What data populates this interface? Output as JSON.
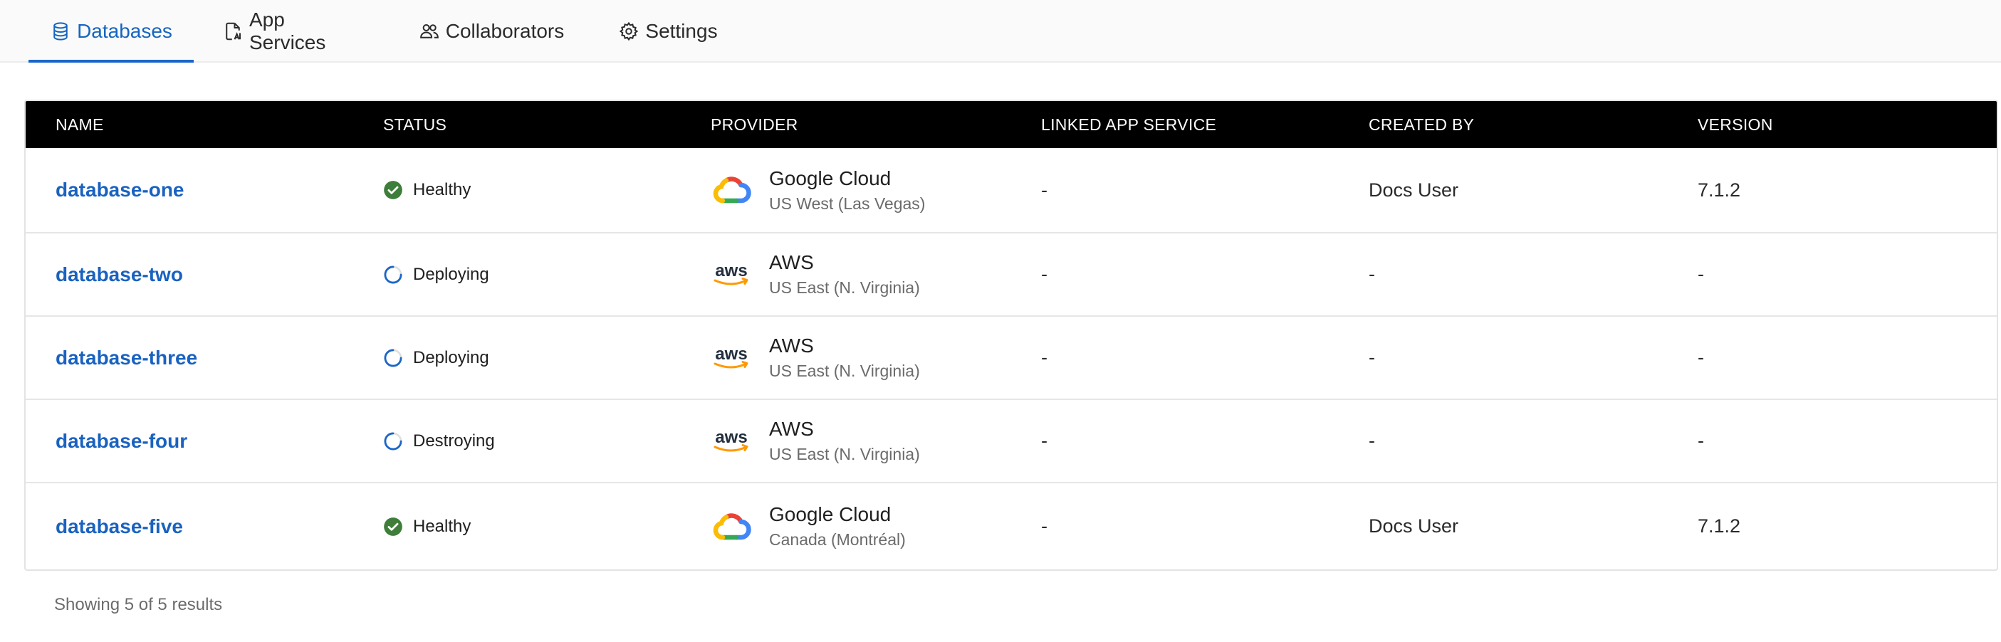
{
  "tabs": [
    {
      "label": "Databases",
      "icon": "database-icon",
      "active": true
    },
    {
      "label": "App Services",
      "icon": "app-services-icon",
      "active": false
    },
    {
      "label": "Collaborators",
      "icon": "people-icon",
      "active": false
    },
    {
      "label": "Settings",
      "icon": "gear-icon",
      "active": false
    }
  ],
  "table": {
    "headers": [
      "NAME",
      "STATUS",
      "PROVIDER",
      "LINKED APP SERVICE",
      "CREATED BY",
      "VERSION"
    ],
    "rows": [
      {
        "name": "database-one",
        "status": "Healthy",
        "status_icon": "check-circle-icon",
        "provider": "Google Cloud",
        "provider_icon": "google-cloud-logo",
        "region": "US West (Las Vegas)",
        "linked": "-",
        "created_by": "Docs User",
        "version": "7.1.2"
      },
      {
        "name": "database-two",
        "status": "Deploying",
        "status_icon": "spinner-icon",
        "provider": "AWS",
        "provider_icon": "aws-logo",
        "region": "US East (N. Virginia)",
        "linked": "-",
        "created_by": "-",
        "version": "-"
      },
      {
        "name": "database-three",
        "status": "Deploying",
        "status_icon": "spinner-icon",
        "provider": "AWS",
        "provider_icon": "aws-logo",
        "region": "US East (N. Virginia)",
        "linked": "-",
        "created_by": "-",
        "version": "-"
      },
      {
        "name": "database-four",
        "status": "Destroying",
        "status_icon": "spinner-icon",
        "provider": "AWS",
        "provider_icon": "aws-logo",
        "region": "US East (N. Virginia)",
        "linked": "-",
        "created_by": "-",
        "version": "-"
      },
      {
        "name": "database-five",
        "status": "Healthy",
        "status_icon": "check-circle-icon",
        "provider": "Google Cloud",
        "provider_icon": "google-cloud-logo",
        "region": "Canada (Montréal)",
        "linked": "-",
        "created_by": "Docs User",
        "version": "7.1.2"
      }
    ]
  },
  "footer": {
    "results_text": "Showing 5 of 5 results"
  },
  "colors": {
    "accent": "#1a62c0",
    "header_bg": "#000000",
    "healthy": "#3e7d3a",
    "spinner": "#1a66c9"
  }
}
